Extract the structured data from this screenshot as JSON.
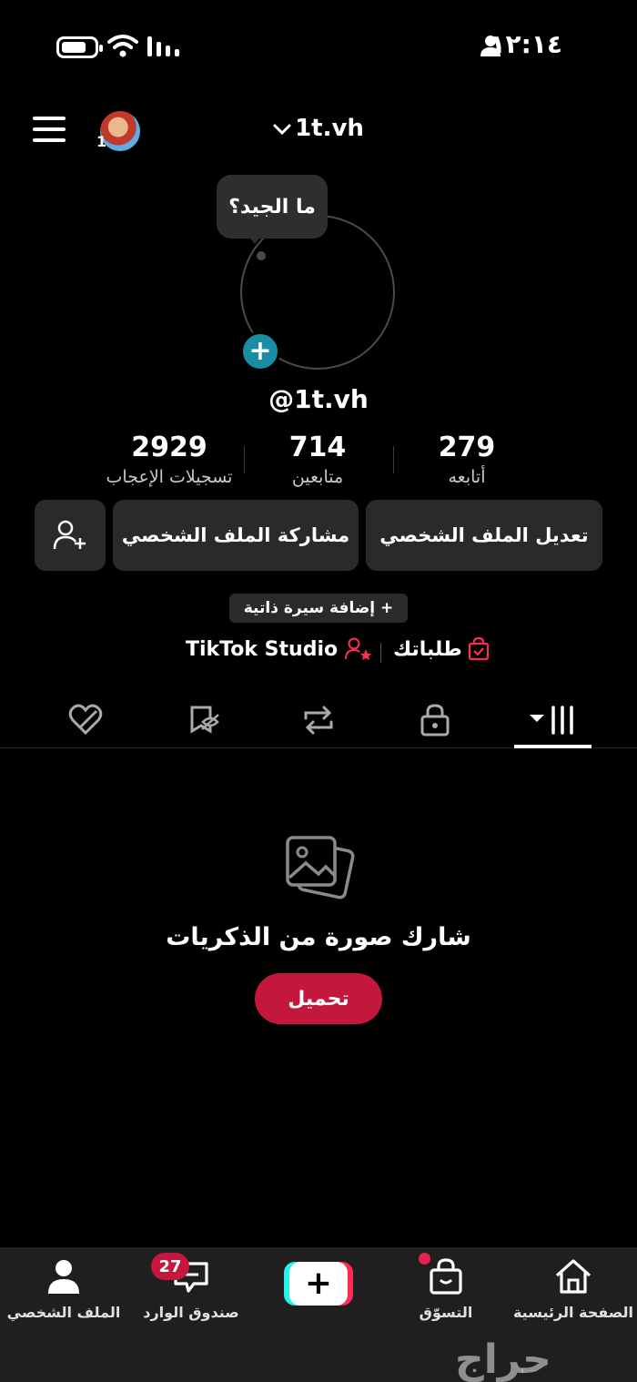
{
  "status_bar": {
    "time": "١٢:١٤"
  },
  "header": {
    "username": "1t.vh",
    "avatar_badge": "1"
  },
  "profile": {
    "bubble_text": "ما الجيد؟",
    "handle": "@1t.vh",
    "stats": [
      {
        "value": "279",
        "label": "أتابعه"
      },
      {
        "value": "714",
        "label": "متابعين"
      },
      {
        "value": "2929",
        "label": "تسجيلات الإعجاب"
      }
    ],
    "edit_label": "تعديل الملف الشخصي",
    "share_label": "مشاركة الملف الشخصي",
    "bio_label": "+ إضافة سيرة ذاتية",
    "orders_label": "طلباتك",
    "studio_label": "TikTok Studio"
  },
  "empty_state": {
    "text": "شارك صورة من الذكريات",
    "upload_label": "تحميل"
  },
  "bottom_nav": {
    "home": "الصفحة الرئيسية",
    "shop": "التسوّق",
    "inbox": "صندوق الوارد",
    "inbox_count": "27",
    "profile": "الملف الشخصي"
  },
  "watermark": "حراج",
  "colors": {
    "accent": "#c4173d",
    "teal": "#1a8ca3",
    "button_bg": "#2a2a2a"
  }
}
